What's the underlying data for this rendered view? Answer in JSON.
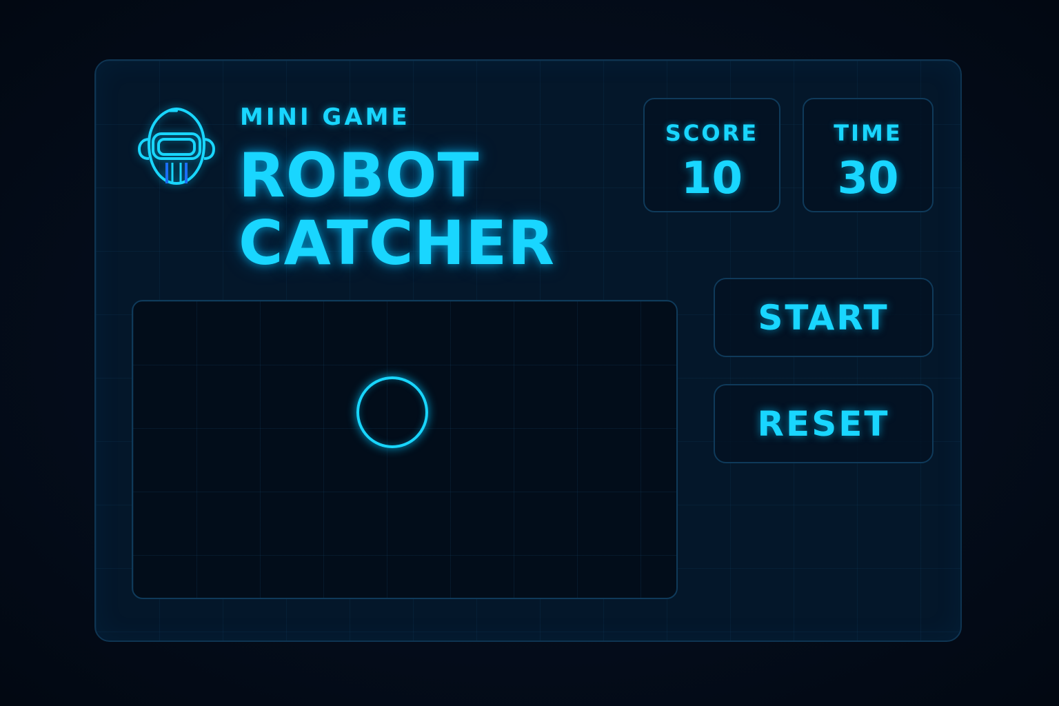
{
  "header": {
    "subtitle": "MINI GAME",
    "title_line1": "ROBOT",
    "title_line2": "CATCHER",
    "icon": "robot-head-icon"
  },
  "stats": {
    "score_label": "SCORE",
    "score_value": "10",
    "time_label": "TIME",
    "time_value": "30"
  },
  "controls": {
    "start_label": "START",
    "reset_label": "RESET"
  },
  "arena": {
    "target_icon": "circle-target"
  },
  "colors": {
    "accent": "#19d6ff",
    "background": "#030b17",
    "panel": "#04172a",
    "border": "#0f3a5a"
  }
}
